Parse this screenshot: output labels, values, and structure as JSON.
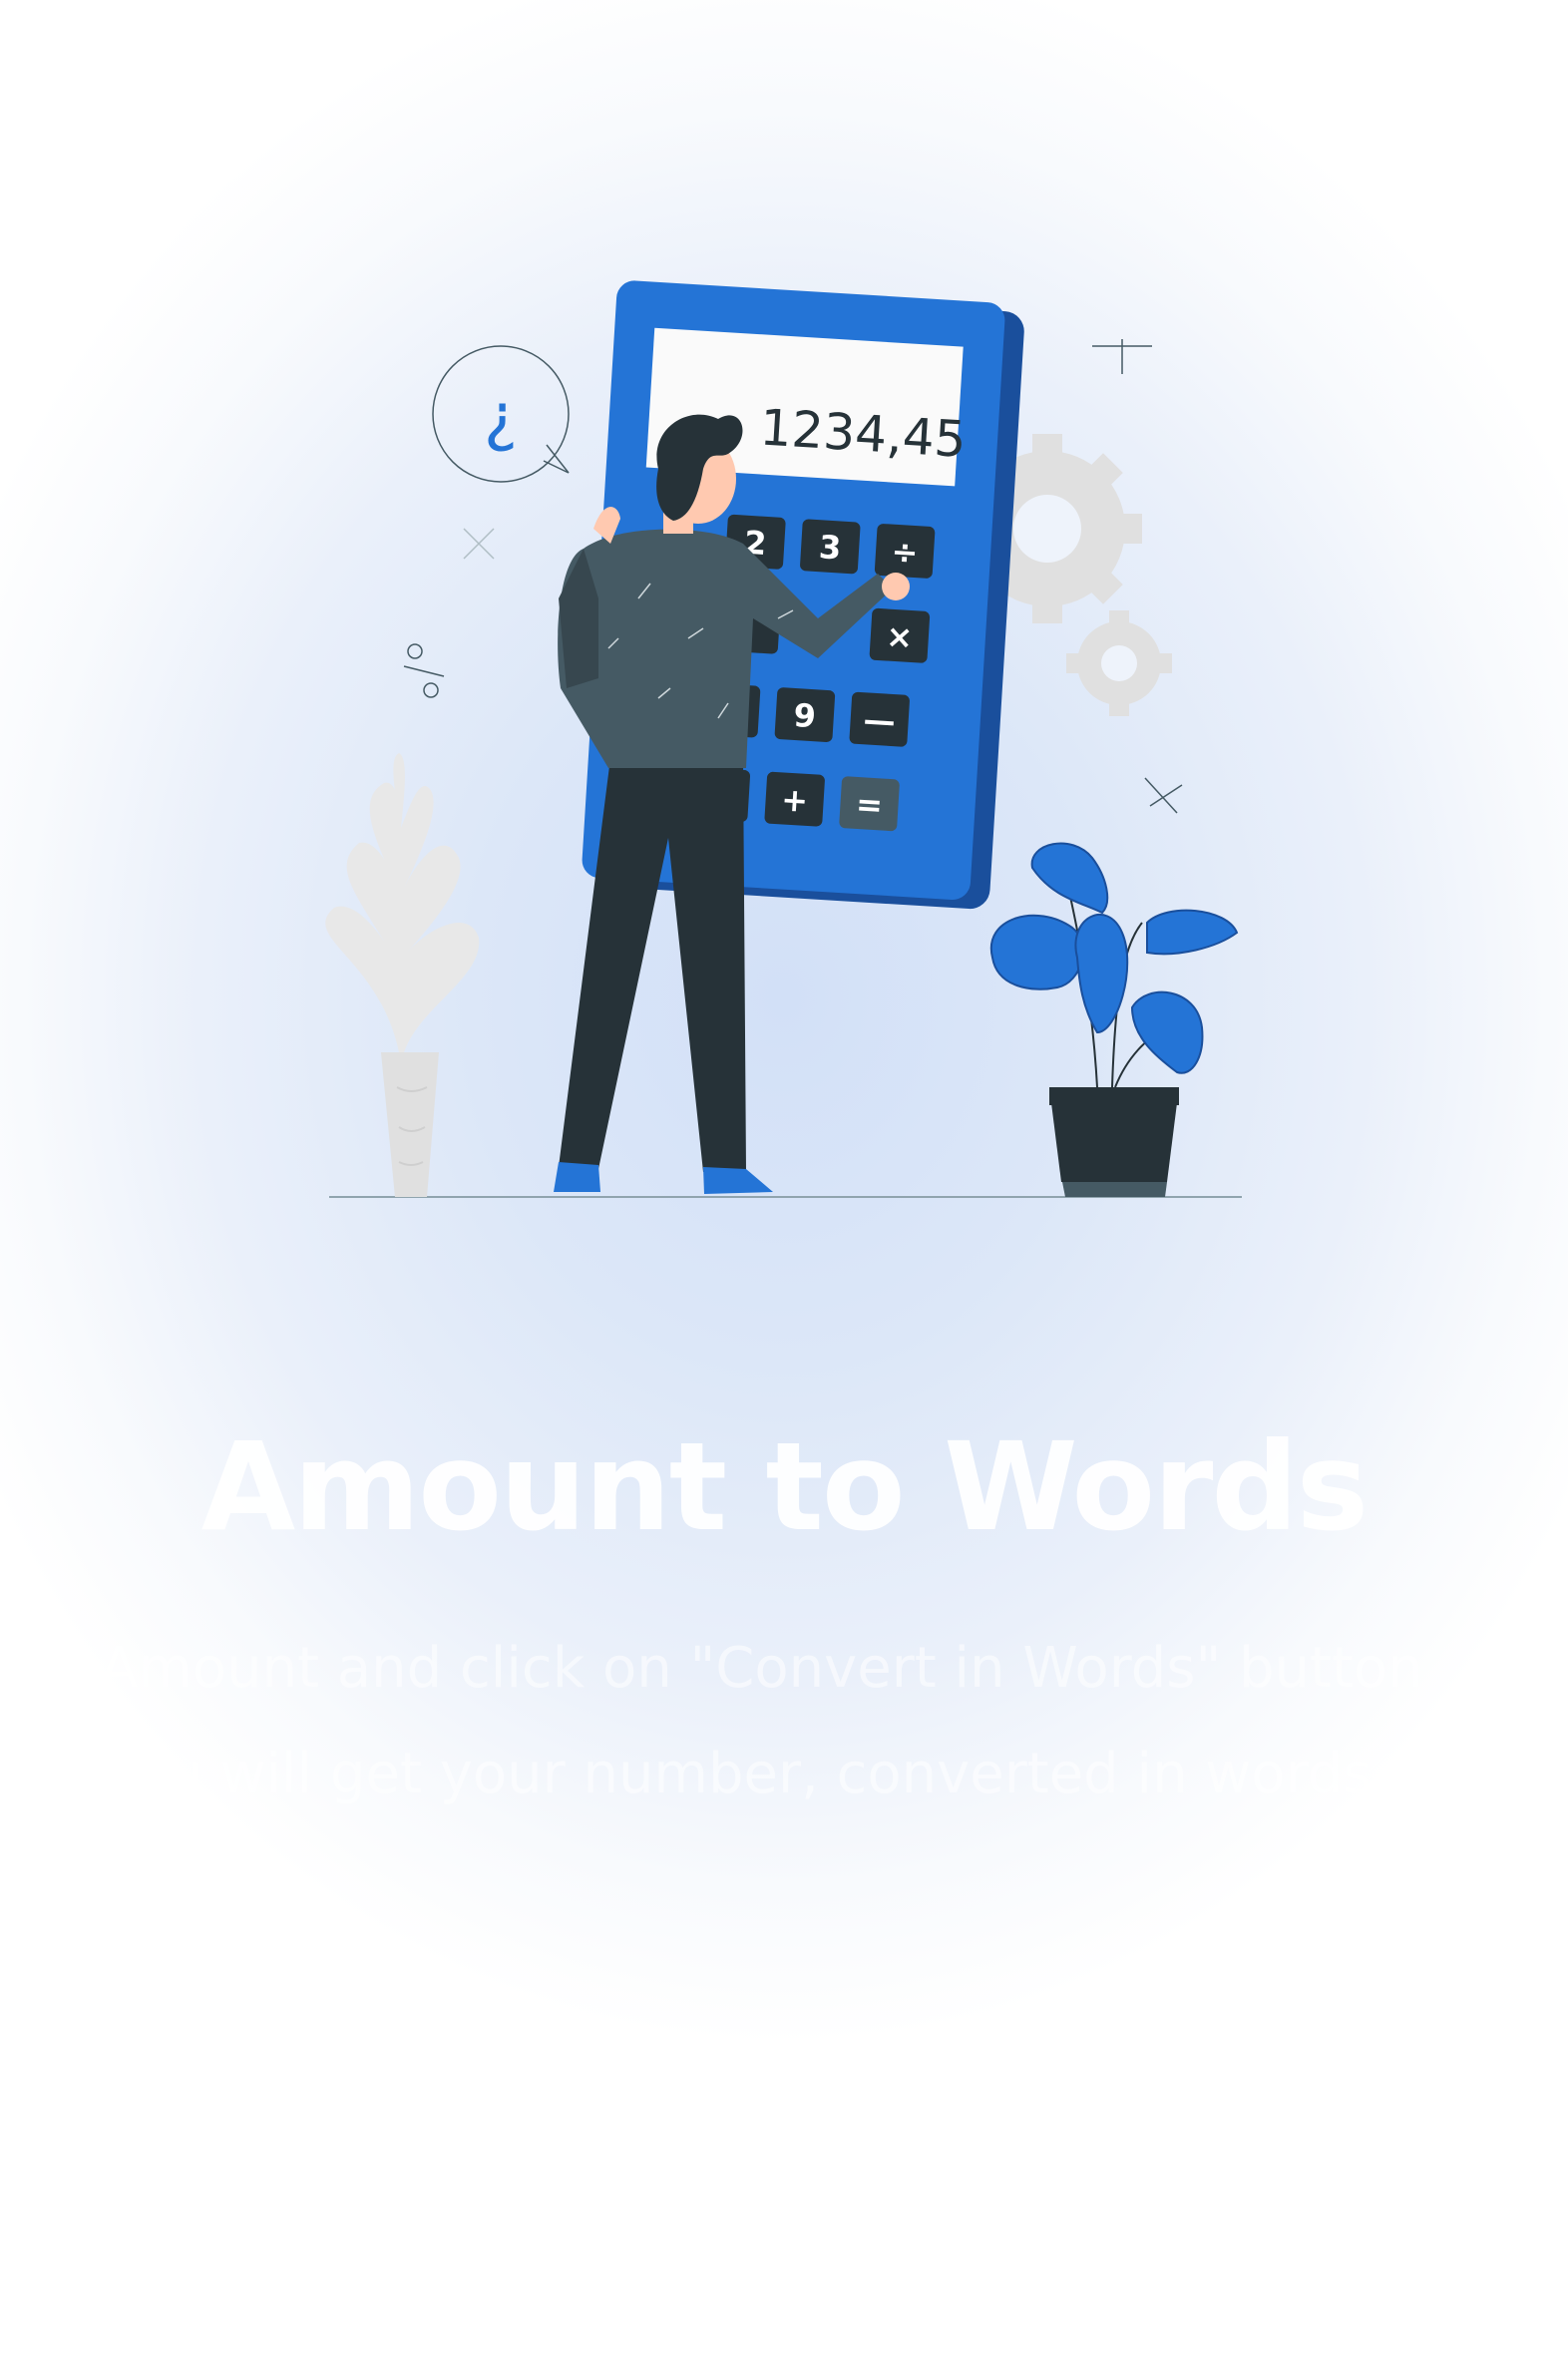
{
  "illustration": {
    "calculator_display": "1234,45",
    "keys": [
      "2",
      "3",
      "÷",
      "×",
      "9",
      "—",
      "+",
      "="
    ],
    "speech_bubble_symbol": "¿",
    "percent_symbol": "%",
    "icons": [
      "calculator-icon",
      "gear-icon",
      "plant-icon",
      "question-bubble-icon",
      "person-figure"
    ]
  },
  "hero": {
    "title": "Amount to Words",
    "description": "Amount and click on \"Convert in Words\" button you will get your number, converted in words..."
  },
  "colors": {
    "accent": "#2474d6",
    "dark": "#263238",
    "title": "#ffffff"
  }
}
